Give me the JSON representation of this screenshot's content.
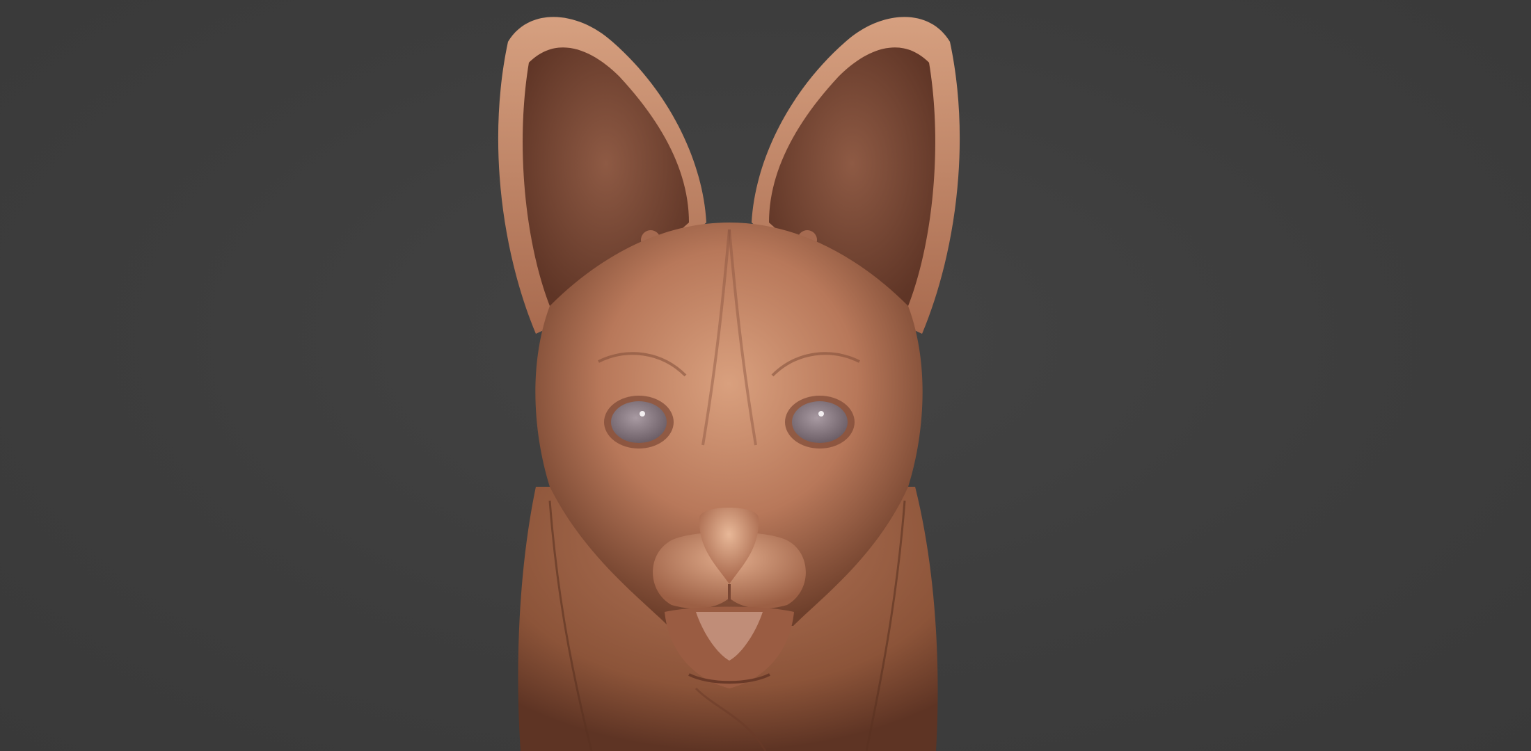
{
  "scene": {
    "subject": "serval-head-sculpt-icon",
    "colors": {
      "background": "#3c3c3c",
      "clay_light": "#d9a07e",
      "clay_mid": "#b8785a",
      "clay_dark": "#6e3f2b",
      "eye": "#8f8088",
      "eye_highlight": "#f2eef0"
    }
  }
}
